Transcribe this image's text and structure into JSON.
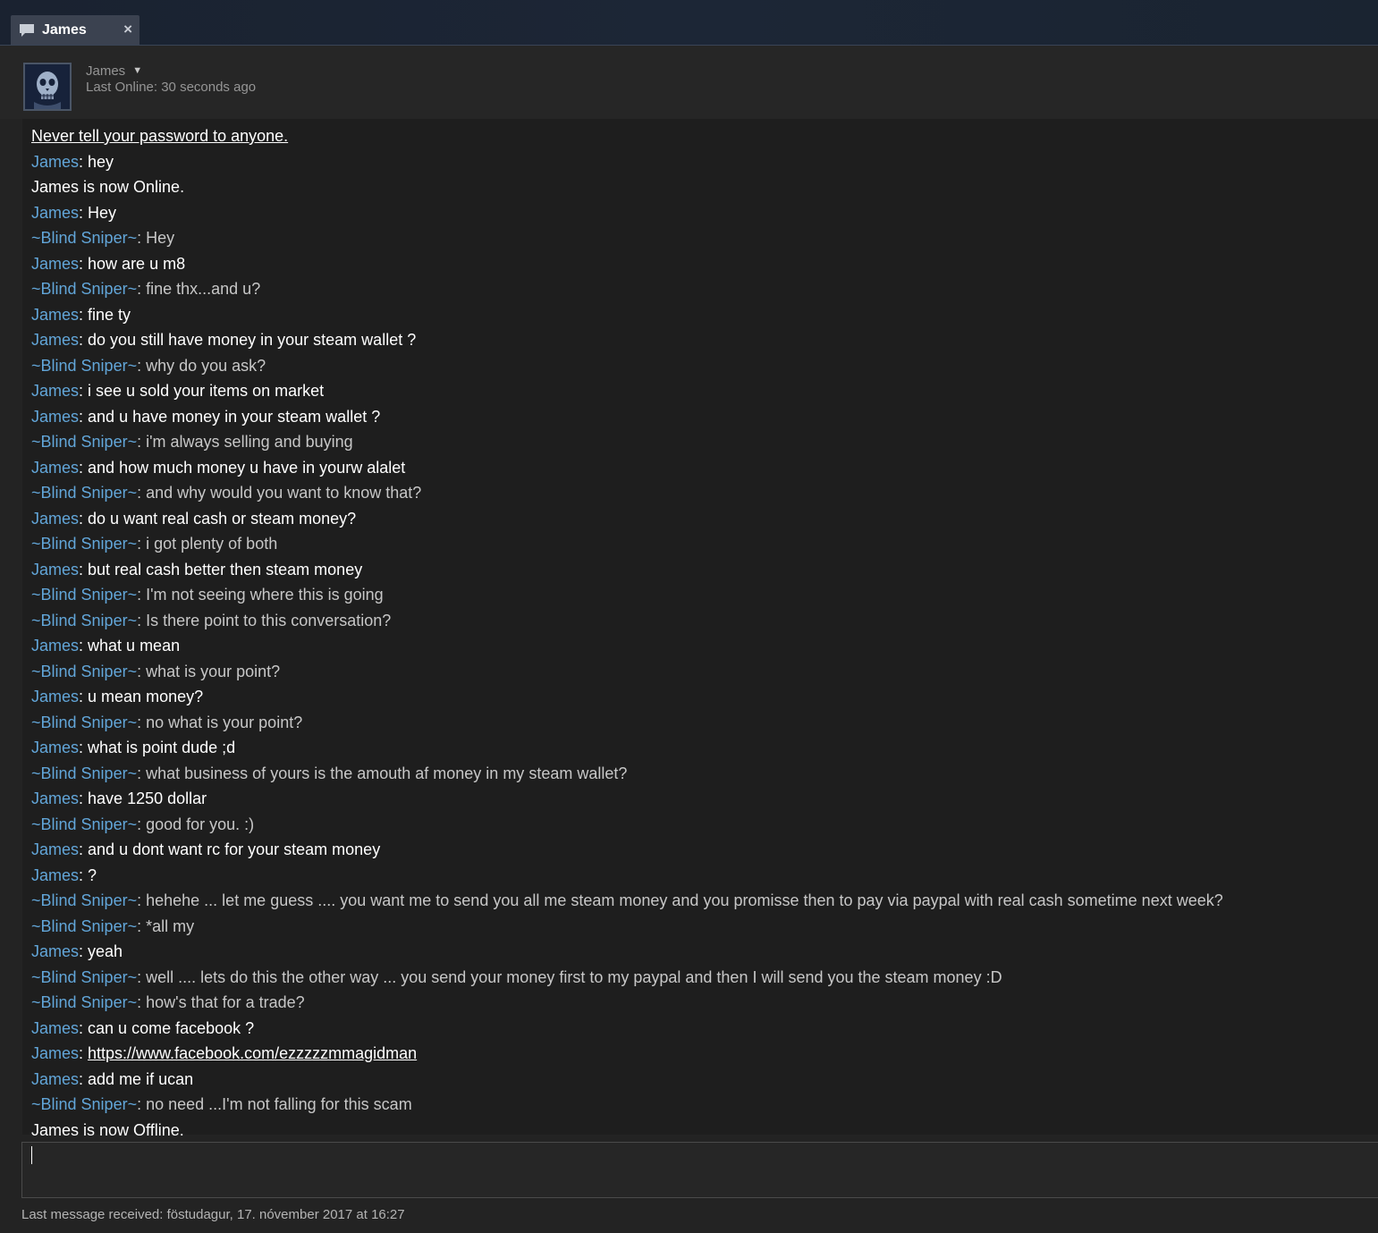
{
  "tab": {
    "label": "James",
    "close": "×",
    "icon": "chat-bubble-icon"
  },
  "header": {
    "name": "James",
    "status": "Last Online: 30 seconds ago",
    "avatar_icon": "skull-avatar-icon"
  },
  "chat": {
    "warning": "Never tell your password to anyone.",
    "messages": [
      {
        "type": "msg",
        "sender": "James",
        "text": "hey",
        "who": "james"
      },
      {
        "type": "system",
        "text": "James is now Online."
      },
      {
        "type": "msg",
        "sender": "James",
        "text": "Hey",
        "who": "james"
      },
      {
        "type": "msg",
        "sender": "~Blind Sniper~",
        "text": "Hey",
        "who": "blind"
      },
      {
        "type": "msg",
        "sender": "James",
        "text": "how are u m8",
        "who": "james"
      },
      {
        "type": "msg",
        "sender": "~Blind Sniper~",
        "text": "fine thx...and u?",
        "who": "blind"
      },
      {
        "type": "msg",
        "sender": "James",
        "text": "fine ty",
        "who": "james"
      },
      {
        "type": "msg",
        "sender": "James",
        "text": "do you still have money in your steam wallet ?",
        "who": "james"
      },
      {
        "type": "msg",
        "sender": "~Blind Sniper~",
        "text": "why do you ask?",
        "who": "blind"
      },
      {
        "type": "msg",
        "sender": "James",
        "text": "i see u sold your items on market",
        "who": "james"
      },
      {
        "type": "msg",
        "sender": "James",
        "text": "and u have money in your steam wallet ?",
        "who": "james"
      },
      {
        "type": "msg",
        "sender": "~Blind Sniper~",
        "text": "i'm always selling and buying",
        "who": "blind"
      },
      {
        "type": "msg",
        "sender": "James",
        "text": "and how much money u have in yourw alalet",
        "who": "james"
      },
      {
        "type": "msg",
        "sender": "~Blind Sniper~",
        "text": "and why would you want to know that?",
        "who": "blind"
      },
      {
        "type": "msg",
        "sender": "James",
        "text": "do u want real cash or steam money?",
        "who": "james"
      },
      {
        "type": "msg",
        "sender": "~Blind Sniper~",
        "text": "i got plenty of both",
        "who": "blind"
      },
      {
        "type": "msg",
        "sender": "James",
        "text": "but real cash better then steam money",
        "who": "james"
      },
      {
        "type": "msg",
        "sender": "~Blind Sniper~",
        "text": "I'm not seeing where this is going",
        "who": "blind"
      },
      {
        "type": "msg",
        "sender": "~Blind Sniper~",
        "text": "Is there point to this conversation?",
        "who": "blind"
      },
      {
        "type": "msg",
        "sender": "James",
        "text": "what u mean",
        "who": "james"
      },
      {
        "type": "msg",
        "sender": "~Blind Sniper~",
        "text": "what is your point?",
        "who": "blind"
      },
      {
        "type": "msg",
        "sender": "James",
        "text": "u mean money?",
        "who": "james"
      },
      {
        "type": "msg",
        "sender": "~Blind Sniper~",
        "text": "no what is your point?",
        "who": "blind"
      },
      {
        "type": "msg",
        "sender": "James",
        "text": "what is point dude ;d",
        "who": "james"
      },
      {
        "type": "msg",
        "sender": "~Blind Sniper~",
        "text": "what business of yours is the amouth af money in my steam wallet?",
        "who": "blind"
      },
      {
        "type": "msg",
        "sender": "James",
        "text": "have 1250 dollar",
        "who": "james"
      },
      {
        "type": "msg",
        "sender": "~Blind Sniper~",
        "text": "good for you. :)",
        "who": "blind"
      },
      {
        "type": "msg",
        "sender": "James",
        "text": "and u dont want rc for your steam money",
        "who": "james"
      },
      {
        "type": "msg",
        "sender": "James",
        "text": "?",
        "who": "james"
      },
      {
        "type": "msg",
        "sender": "~Blind Sniper~",
        "text": "hehehe ... let me guess .... you want me to send you all me steam money and you promisse then to pay via paypal with real cash sometime next week?",
        "who": "blind"
      },
      {
        "type": "msg",
        "sender": "~Blind Sniper~",
        "text": "*all my",
        "who": "blind"
      },
      {
        "type": "msg",
        "sender": "James",
        "text": "yeah",
        "who": "james"
      },
      {
        "type": "msg",
        "sender": "~Blind Sniper~",
        "text": "well .... lets do this the other way ... you send your money first to my paypal and then I will send you the steam money :D",
        "who": "blind"
      },
      {
        "type": "msg",
        "sender": "~Blind Sniper~",
        "text": "how's that for a trade?",
        "who": "blind"
      },
      {
        "type": "msg",
        "sender": "James",
        "text": "can u come facebook ?",
        "who": "james"
      },
      {
        "type": "msg",
        "sender": "James",
        "text": "https://www.facebook.com/ezzzzzmmagidman",
        "who": "james",
        "link": true
      },
      {
        "type": "msg",
        "sender": "James",
        "text": "add me if ucan",
        "who": "james"
      },
      {
        "type": "msg",
        "sender": "~Blind Sniper~",
        "text": "no need ...I'm not falling for this scam",
        "who": "blind"
      },
      {
        "type": "system",
        "text": "James is now Offline."
      }
    ]
  },
  "input": {
    "value": ""
  },
  "footer": {
    "last_received": "Last message received: föstudagur, 17. nóvember 2017 at 16:27"
  }
}
